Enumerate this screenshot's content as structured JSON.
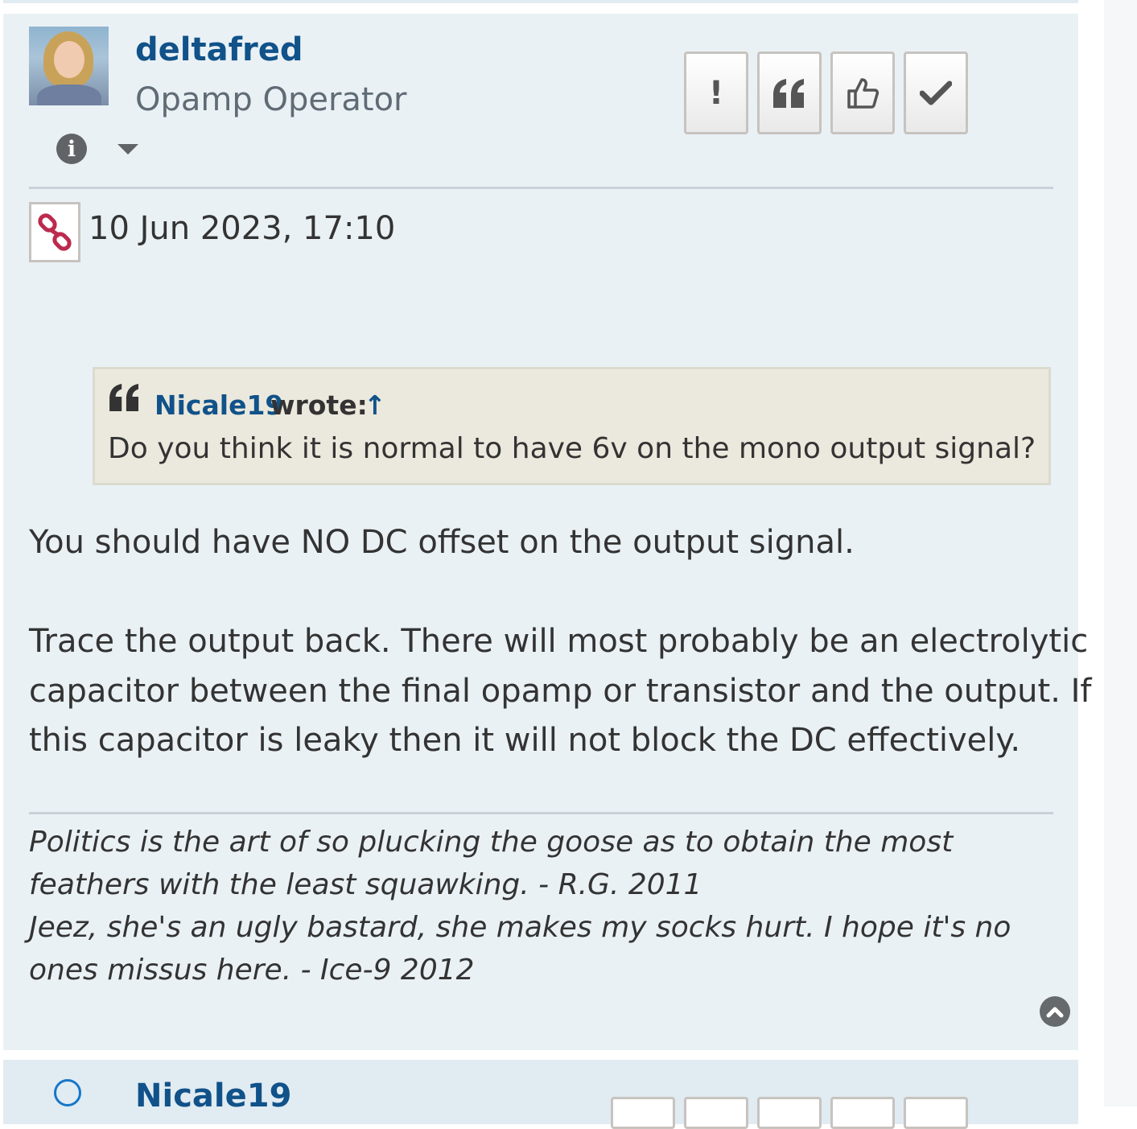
{
  "post": {
    "author": "deltafred",
    "rank": "Opamp Operator",
    "date": "10 Jun 2023, 17:10",
    "buttons": [
      {
        "label": "!",
        "icon": "report-icon"
      },
      {
        "label": "❝",
        "icon": "quote-icon"
      },
      {
        "label": "thumbs-up",
        "icon": "thumbs-up-icon"
      },
      {
        "label": "✔",
        "icon": "check-icon"
      }
    ],
    "quote": {
      "author": "Nicale19",
      "wrote": "wrote:",
      "arrow": "↑",
      "text": "Do you think it is normal to have 6v on the mono output signal?"
    },
    "body": {
      "para1": "You should have NO DC offset on the output signal.",
      "para2_line1": "Trace the output back. There will most probably be an electrolytic",
      "para2_line2": "capacitor between the final opamp or transistor and the output. If",
      "para2_line3": "this capacitor is leaky then it will not block the DC effectively."
    },
    "signature": {
      "line1": "Politics is the art of so plucking the goose as to obtain the most",
      "line2": "feathers with the least squawking. - R.G. 2011",
      "line3": "Jeez, she's an ugly bastard, she makes my socks hurt. I hope it's no",
      "line4": "ones missus here. - Ice-9 2012"
    }
  },
  "next_post": {
    "author": "Nicale19"
  },
  "colors": {
    "post_bg": "#eaf1f5",
    "link": "#105289",
    "quote_bg": "#ebe8dd",
    "permalink_red": "#bc2a4d"
  }
}
